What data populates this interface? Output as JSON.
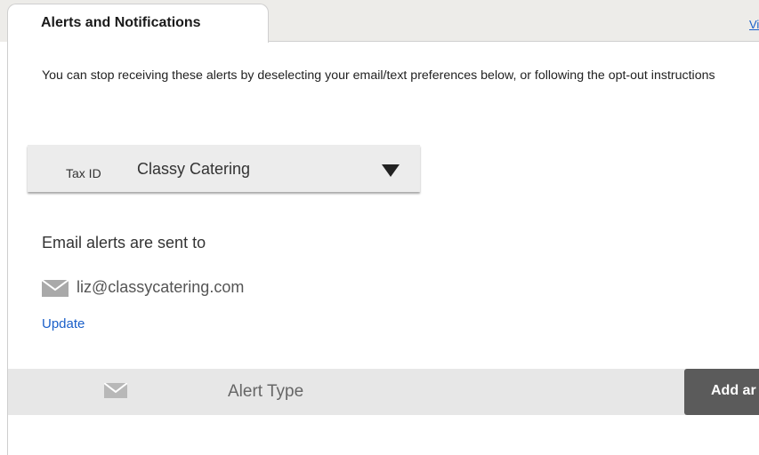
{
  "tabs": {
    "active_label": "Alerts and Notifications",
    "right_link_label": "Vi"
  },
  "intro": {
    "text": "You can stop receiving these alerts by deselecting your email/text preferences below, or following the opt-out instructions"
  },
  "tax_select": {
    "label": "Tax ID",
    "selected_value": "Classy Catering"
  },
  "email_section": {
    "heading": "Email alerts are sent to",
    "address": "liz@classycatering.com",
    "update_label": "Update"
  },
  "alerts_table": {
    "column_header": "Alert Type",
    "add_button_label": "Add ar"
  },
  "icons": {
    "email_icon": "envelope-icon",
    "dropdown_icon": "caret-down-icon"
  },
  "colors": {
    "link": "#1a5fc9",
    "header_bg": "#e7e7e7",
    "button_bg": "#5b5b5b"
  }
}
